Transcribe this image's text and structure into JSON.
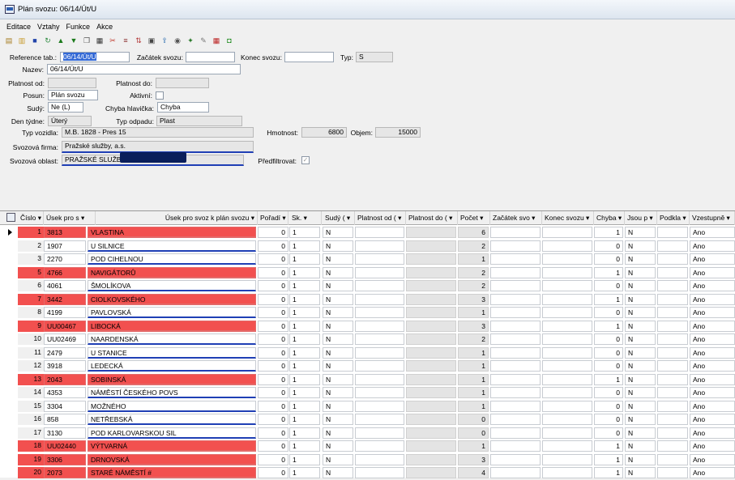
{
  "window": {
    "title": "Plán svozu: 06/14/Út/U"
  },
  "menu": [
    "Editace",
    "Vztahy",
    "Funkce",
    "Akce"
  ],
  "toolbar": [
    "open-icon",
    "folder-icon",
    "save-icon",
    "refresh-icon",
    "up-icon",
    "down-icon",
    "copy-icon",
    "print-icon",
    "cut-icon",
    "filter-icon",
    "sort-icon",
    "report-icon",
    "export-icon",
    "preview-icon",
    "settings-icon",
    "tools-icon",
    "calendar-icon",
    "exit-icon"
  ],
  "form": {
    "reference_label": "Reference tab.:",
    "reference_value": "06/14/Út/U",
    "zacatek_label": "Začátek svozu:",
    "zacatek_value": "",
    "konec_label": "Konec svozu:",
    "konec_value": "",
    "typ_label": "Typ:",
    "typ_value": "S",
    "nazev_label": "Nazev:",
    "nazev_value": "06/14/Út/U",
    "platnost_od_label": "Platnost od:",
    "platnost_od_value": "",
    "platnost_do_label": "Platnost do:",
    "platnost_do_value": "",
    "posun_label": "Posun:",
    "posun_value": "Plán svozu",
    "aktivni_label": "Aktivní:",
    "sudy_label": "Sudý:",
    "sudy_value": "Ne (L)",
    "chyba_label": "Chyba hlavička:",
    "chyba_value": "Chyba",
    "den_label": "Den týdne:",
    "den_value": "Úterý",
    "typ_odpadu_label": "Typ odpadu:",
    "typ_odpadu_value": "Plast",
    "typ_vozidla_label": "Typ vozidla:",
    "typ_vozidla_value": "M.B. 1828 - Pres 15",
    "hmotnost_label": "Hmotnost:",
    "hmotnost_value": "6800",
    "objem_label": "Objem:",
    "objem_value": "15000",
    "firma_label": "Svozová firma:",
    "firma_value": "Pražské služby, a.s.",
    "oblast_label": "Svozová oblast:",
    "oblast_value": "PRAŽSKÉ SLUŽBY",
    "predfiltrovat_label": "Předfiltrovat:"
  },
  "grid": {
    "headers": [
      "Číslo ▾",
      "Úsek pro s ▾",
      "Úsek pro svoz k plán svozu ▾",
      "Pořadí ▾",
      "Sk. ▾",
      "Sudý ( ▾",
      "Platnost od ( ▾",
      "Platnost do ( ▾",
      "Počet ▾",
      "Začátek svo ▾",
      "Konec svozu ▾",
      "Chyba ▾",
      "Jsou p ▾",
      "Podkla ▾",
      "Vzestupně ▾"
    ],
    "rows": [
      {
        "n": "1",
        "code": "3813",
        "name": "VLASTINA",
        "poradi": "0",
        "sk": "1",
        "sudy": "N",
        "pocet": "6",
        "chyba": "1",
        "jsou": "N",
        "vz": "Ano",
        "hi": true
      },
      {
        "n": "2",
        "code": "1907",
        "name": "U SILNICE",
        "poradi": "0",
        "sk": "1",
        "sudy": "N",
        "pocet": "2",
        "chyba": "0",
        "jsou": "N",
        "vz": "Ano",
        "hi": false
      },
      {
        "n": "3",
        "code": "2270",
        "name": "POD CIHELNOU",
        "poradi": "0",
        "sk": "1",
        "sudy": "N",
        "pocet": "1",
        "chyba": "0",
        "jsou": "N",
        "vz": "Ano",
        "hi": false
      },
      {
        "n": "5",
        "code": "4766",
        "name": "NAVIGÁTORŮ",
        "poradi": "0",
        "sk": "1",
        "sudy": "N",
        "pocet": "2",
        "chyba": "1",
        "jsou": "N",
        "vz": "Ano",
        "hi": true
      },
      {
        "n": "6",
        "code": "4061",
        "name": "ŠMOLÍKOVA",
        "poradi": "0",
        "sk": "1",
        "sudy": "N",
        "pocet": "2",
        "chyba": "0",
        "jsou": "N",
        "vz": "Ano",
        "hi": false
      },
      {
        "n": "7",
        "code": "3442",
        "name": "CIOLKOVSKÉHO",
        "poradi": "0",
        "sk": "1",
        "sudy": "N",
        "pocet": "3",
        "chyba": "1",
        "jsou": "N",
        "vz": "Ano",
        "hi": true
      },
      {
        "n": "8",
        "code": "4199",
        "name": "PAVLOVSKÁ",
        "poradi": "0",
        "sk": "1",
        "sudy": "N",
        "pocet": "1",
        "chyba": "0",
        "jsou": "N",
        "vz": "Ano",
        "hi": false
      },
      {
        "n": "9",
        "code": "UU00467",
        "name": "LIBOCKÁ",
        "poradi": "0",
        "sk": "1",
        "sudy": "N",
        "pocet": "3",
        "chyba": "1",
        "jsou": "N",
        "vz": "Ano",
        "hi": true
      },
      {
        "n": "10",
        "code": "UU02469",
        "name": "NAARDENSKÁ",
        "poradi": "0",
        "sk": "1",
        "sudy": "N",
        "pocet": "2",
        "chyba": "0",
        "jsou": "N",
        "vz": "Ano",
        "hi": false
      },
      {
        "n": "11",
        "code": "2479",
        "name": "U STANICE",
        "poradi": "0",
        "sk": "1",
        "sudy": "N",
        "pocet": "1",
        "chyba": "0",
        "jsou": "N",
        "vz": "Ano",
        "hi": false
      },
      {
        "n": "12",
        "code": "3918",
        "name": "LEDECKÁ",
        "poradi": "0",
        "sk": "1",
        "sudy": "N",
        "pocet": "1",
        "chyba": "0",
        "jsou": "N",
        "vz": "Ano",
        "hi": false
      },
      {
        "n": "13",
        "code": "2043",
        "name": "SOBINSKÁ",
        "poradi": "0",
        "sk": "1",
        "sudy": "N",
        "pocet": "1",
        "chyba": "1",
        "jsou": "N",
        "vz": "Ano",
        "hi": true
      },
      {
        "n": "14",
        "code": "4353",
        "name": "NÁMĚSTÍ ČESKÉHO POVS",
        "poradi": "0",
        "sk": "1",
        "sudy": "N",
        "pocet": "1",
        "chyba": "0",
        "jsou": "N",
        "vz": "Ano",
        "hi": false
      },
      {
        "n": "15",
        "code": "3304",
        "name": "MOŽNÉHO",
        "poradi": "0",
        "sk": "1",
        "sudy": "N",
        "pocet": "1",
        "chyba": "0",
        "jsou": "N",
        "vz": "Ano",
        "hi": false
      },
      {
        "n": "16",
        "code": "858",
        "name": "NETŘEBSKÁ",
        "poradi": "0",
        "sk": "1",
        "sudy": "N",
        "pocet": "0",
        "chyba": "0",
        "jsou": "N",
        "vz": "Ano",
        "hi": false
      },
      {
        "n": "17",
        "code": "3130",
        "name": "POD KARLOVARSKOU SIL",
        "poradi": "0",
        "sk": "1",
        "sudy": "N",
        "pocet": "0",
        "chyba": "0",
        "jsou": "N",
        "vz": "Ano",
        "hi": false
      },
      {
        "n": "18",
        "code": "UU02440",
        "name": "VÝTVARNÁ",
        "poradi": "0",
        "sk": "1",
        "sudy": "N",
        "pocet": "1",
        "chyba": "1",
        "jsou": "N",
        "vz": "Ano",
        "hi": true
      },
      {
        "n": "19",
        "code": "3306",
        "name": "DRNOVSKÁ",
        "poradi": "0",
        "sk": "1",
        "sudy": "N",
        "pocet": "3",
        "chyba": "1",
        "jsou": "N",
        "vz": "Ano",
        "hi": true
      },
      {
        "n": "20",
        "code": "2073",
        "name": "STARÉ NÁMĚSTÍ #",
        "poradi": "0",
        "sk": "1",
        "sudy": "N",
        "pocet": "4",
        "chyba": "1",
        "jsou": "N",
        "vz": "Ano",
        "hi": true
      }
    ]
  },
  "colors": {
    "highlight": "#f2504f",
    "selection": "#3369d6",
    "underline": "#1f3fb5"
  }
}
